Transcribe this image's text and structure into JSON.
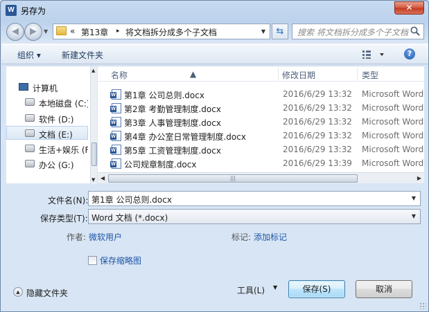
{
  "window": {
    "title": "另存为",
    "app_icon_letter": "W",
    "close_glyph": "✕"
  },
  "address": {
    "prefix": "«",
    "segments": [
      "第13章",
      "将文档拆分成多个子文档"
    ],
    "separator": "▸",
    "search_placeholder": "搜索 将文档拆分成多个子文档"
  },
  "toolbar": {
    "organize": "组织 ▾",
    "new_folder": "新建文件夹",
    "help": "?"
  },
  "nav": {
    "items": [
      {
        "label": "计算机",
        "icon": "computer-icon"
      },
      {
        "label": "本地磁盘 (C:)",
        "icon": "system-drive-icon"
      },
      {
        "label": "软件 (D:)",
        "icon": "drive-icon"
      },
      {
        "label": "文档 (E:)",
        "icon": "drive-icon",
        "selected": true
      },
      {
        "label": "生活+娱乐 (F",
        "icon": "drive-icon"
      },
      {
        "label": "办公 (G:)",
        "icon": "drive-icon"
      }
    ]
  },
  "filelist": {
    "columns": {
      "name": "名称",
      "modified": "修改日期",
      "type": "类型"
    },
    "files": [
      {
        "name": "第1章 公司总则.docx",
        "modified": "2016/6/29 13:32",
        "type": "Microsoft Word"
      },
      {
        "name": "第2章 考勤管理制度.docx",
        "modified": "2016/6/29 13:32",
        "type": "Microsoft Word"
      },
      {
        "name": "第3章 人事管理制度.docx",
        "modified": "2016/6/29 13:32",
        "type": "Microsoft Word"
      },
      {
        "name": "第4章 办公室日常管理制度.docx",
        "modified": "2016/6/29 13:32",
        "type": "Microsoft Word"
      },
      {
        "name": "第5章 工资管理制度.docx",
        "modified": "2016/6/29 13:32",
        "type": "Microsoft Word"
      },
      {
        "name": "公司规章制度.docx",
        "modified": "2016/6/29 13:39",
        "type": "Microsoft Word"
      }
    ]
  },
  "form": {
    "filename_label": "文件名(N):",
    "filename_value": "第1章 公司总则.docx",
    "filetype_label": "保存类型(T):",
    "filetype_value": "Word 文档 (*.docx)",
    "author_label": "作者:",
    "author_value": "微软用户",
    "tags_label": "标记:",
    "tags_value": "添加标记",
    "thumbnail_label": "保存缩略图"
  },
  "footer": {
    "hide_folders": "隐藏文件夹",
    "tools": "工具(L)",
    "save": "保存(S)",
    "cancel": "取消"
  }
}
